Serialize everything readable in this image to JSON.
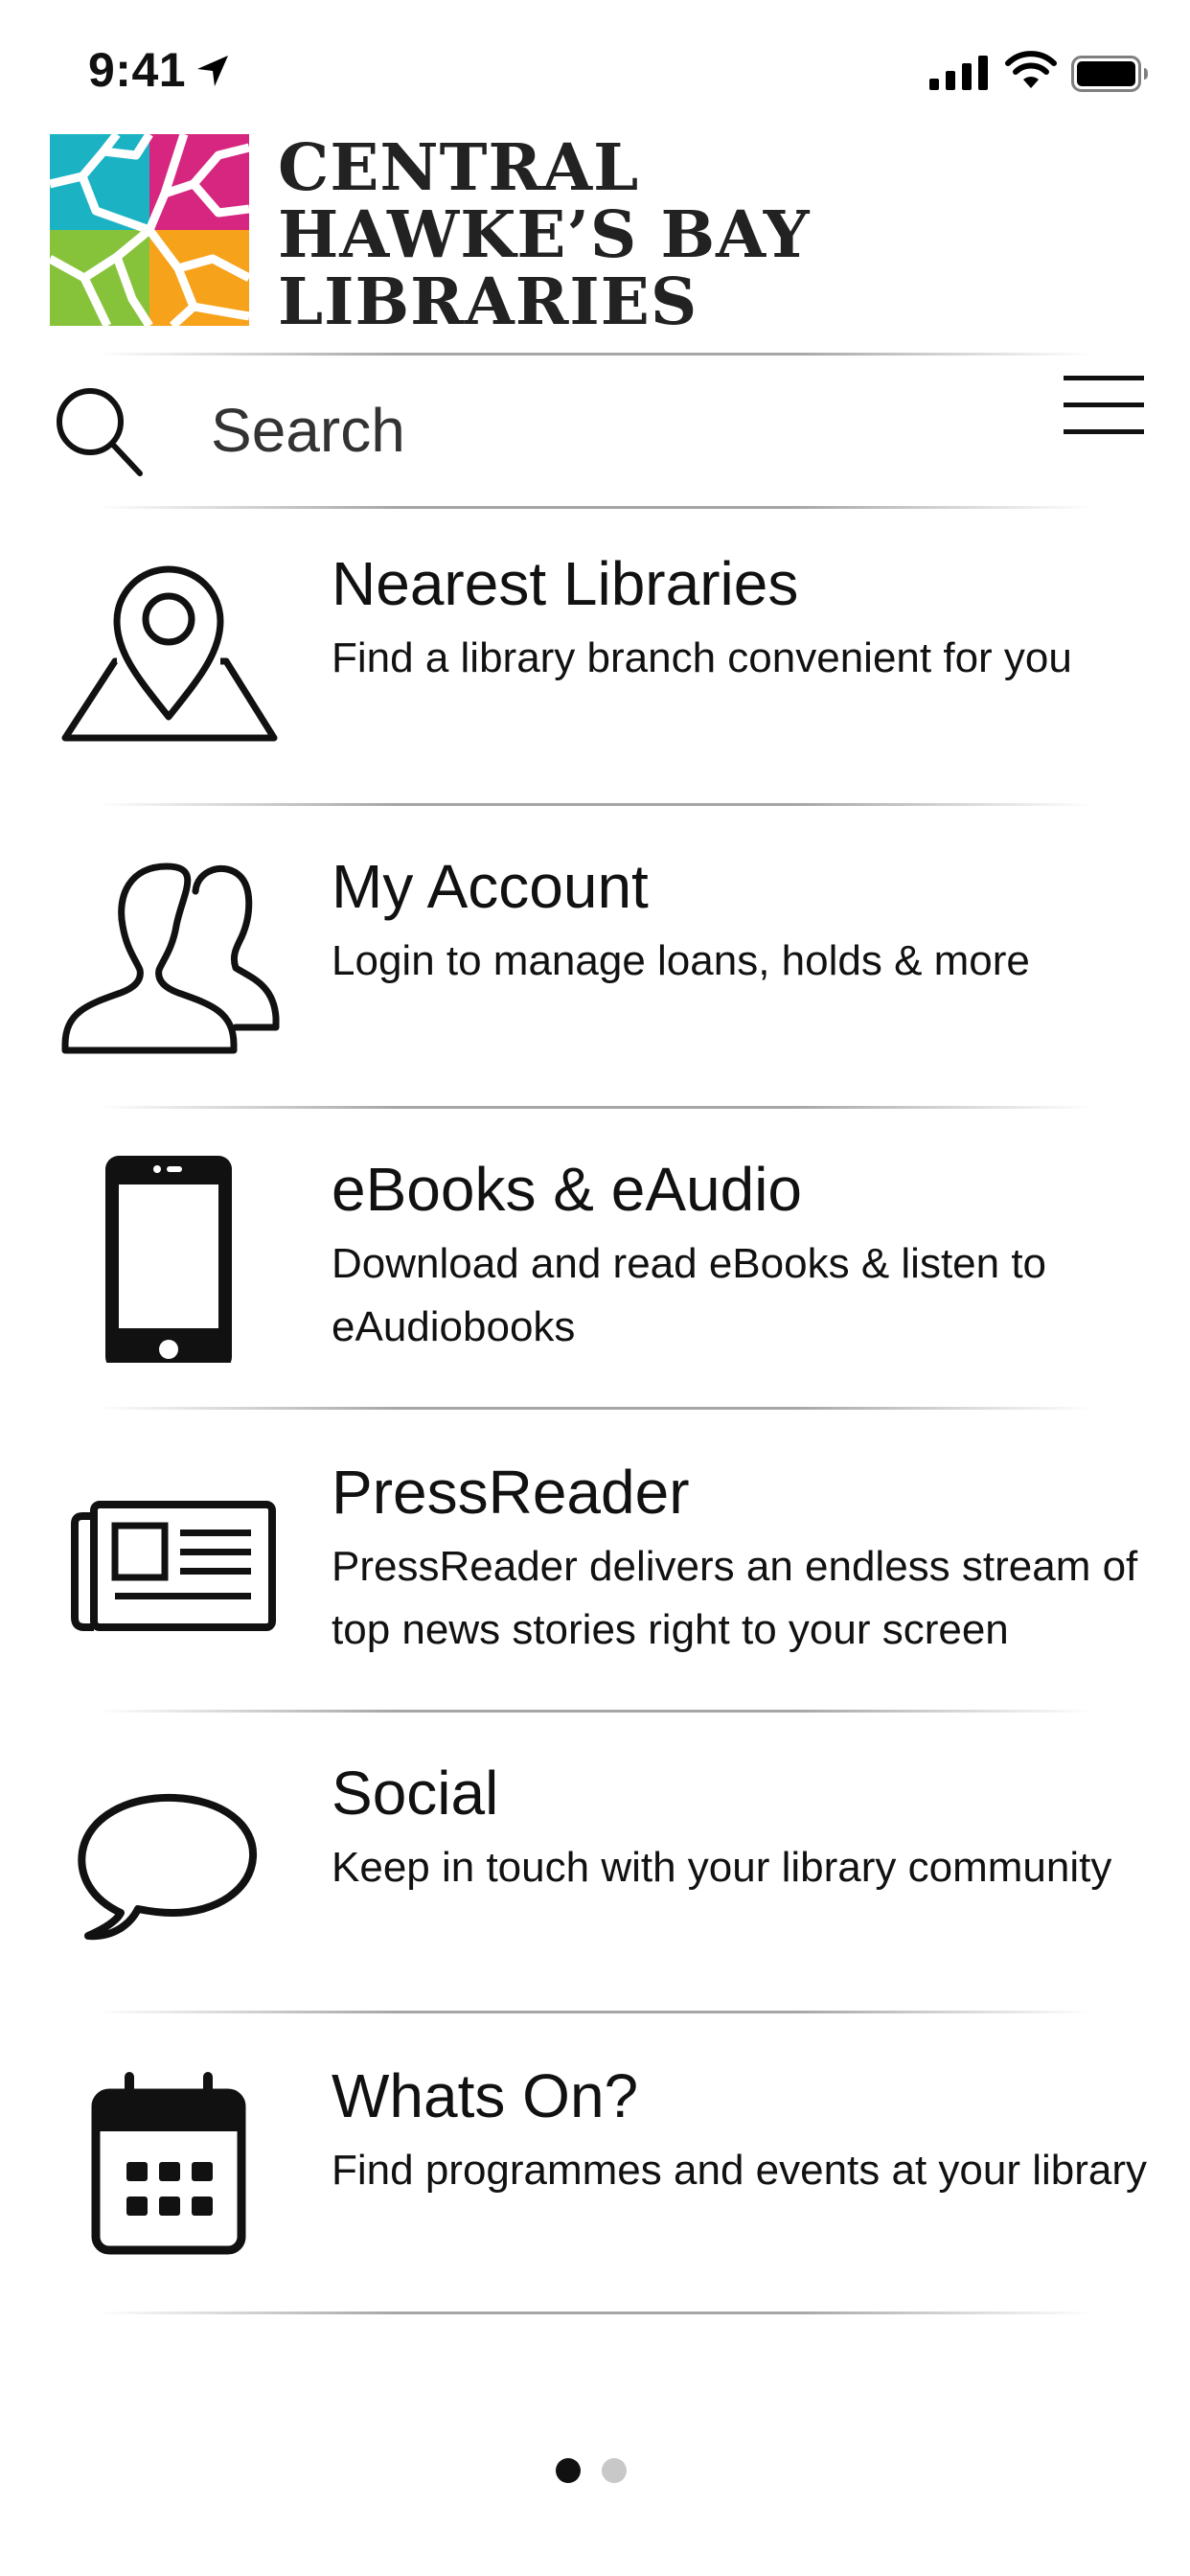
{
  "status": {
    "time": "9:41"
  },
  "logo": {
    "line1": "CENTRAL",
    "line2": "HAWKE’S BAY",
    "line3": "LIBRARIES"
  },
  "search": {
    "placeholder": "Search"
  },
  "items": [
    {
      "title": "Nearest Libraries",
      "desc": "Find a library branch convenient for you",
      "icon": "map-pin-icon"
    },
    {
      "title": "My Account",
      "desc": "Login to manage loans, holds & more",
      "icon": "users-icon"
    },
    {
      "title": "eBooks & eAudio",
      "desc": "Download and read eBooks & listen to eAudiobooks",
      "icon": "phone-icon"
    },
    {
      "title": "PressReader",
      "desc": "PressReader delivers an endless stream of top news stories right to your screen",
      "icon": "newspaper-icon"
    },
    {
      "title": "Social",
      "desc": "Keep in touch with your library community",
      "icon": "speech-bubble-icon"
    },
    {
      "title": "Whats On?",
      "desc": "Find programmes and events at your library",
      "icon": "calendar-icon"
    }
  ],
  "pager": {
    "current": 1,
    "total": 2
  },
  "colors": {
    "logo_teal": "#1bb3c4",
    "logo_magenta": "#d6267f",
    "logo_green": "#86c33a",
    "logo_orange": "#f7a21b"
  }
}
